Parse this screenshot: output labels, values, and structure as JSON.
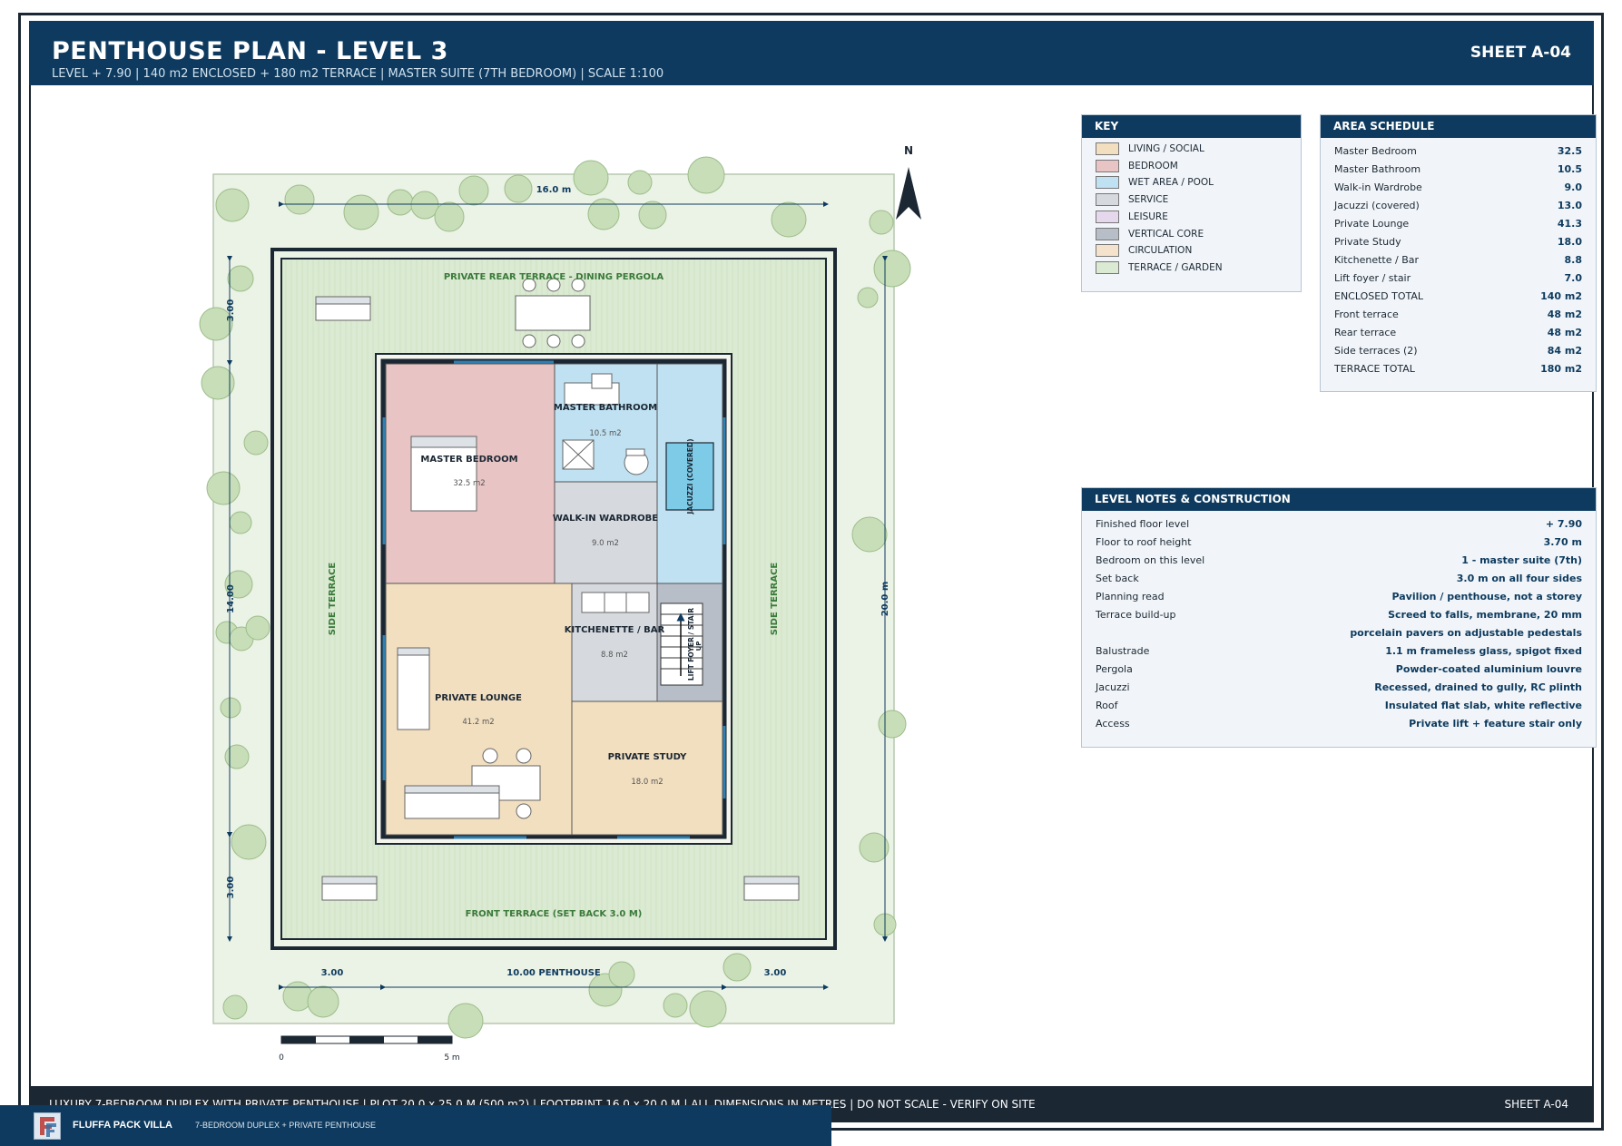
{
  "header": {
    "title": "PENTHOUSE PLAN - LEVEL 3",
    "subtitle": "LEVEL + 7.90  |  140 m2 ENCLOSED + 180 m2 TERRACE  |  MASTER SUITE (7TH BEDROOM)  |  SCALE 1:100",
    "sheet": "SHEET A-04"
  },
  "plan": {
    "north": "N",
    "dims": {
      "top": "16.0 m",
      "right": "20.0 m",
      "left_top": "3.00",
      "left_mid": "14.00",
      "left_bottom": "3.00",
      "bottom_left": "3.00",
      "bottom_mid": "10.00 PENTHOUSE",
      "bottom_right": "3.00"
    },
    "terraces": {
      "rear": "PRIVATE REAR TERRACE  -  DINING PERGOLA",
      "front": "FRONT TERRACE (SET BACK 3.0 M)",
      "side_left": "SIDE TERRACE",
      "side_right": "SIDE TERRACE"
    },
    "rooms": {
      "master_bedroom": {
        "name": "MASTER BEDROOM",
        "area": "32.5 m2"
      },
      "master_bathroom": {
        "name": "MASTER BATHROOM",
        "area": "10.5 m2"
      },
      "walk_in": {
        "name": "WALK-IN WARDROBE",
        "area": "9.0 m2"
      },
      "jacuzzi": {
        "name": "JACUZZI (COVERED)"
      },
      "kitchenette": {
        "name": "KITCHENETTE / BAR",
        "area": "8.8 m2"
      },
      "lift": {
        "name": "LIFT FOYER / STAIR",
        "up": "UP"
      },
      "lounge": {
        "name": "PRIVATE LOUNGE",
        "area": "41.2 m2"
      },
      "study": {
        "name": "PRIVATE STUDY",
        "area": "18.0 m2"
      }
    },
    "scalebar": {
      "start": "0",
      "end": "5 m"
    }
  },
  "key": {
    "title": "KEY",
    "items": [
      {
        "label": "LIVING / SOCIAL",
        "color": "#f2dfc0"
      },
      {
        "label": "BEDROOM",
        "color": "#e8c4c4"
      },
      {
        "label": "WET AREA / POOL",
        "color": "#bfe1f2"
      },
      {
        "label": "SERVICE",
        "color": "#d6d9de"
      },
      {
        "label": "LEISURE",
        "color": "#e6d8ec"
      },
      {
        "label": "VERTICAL CORE",
        "color": "#b7bec7"
      },
      {
        "label": "CIRCULATION",
        "color": "#f4e2cc"
      },
      {
        "label": "TERRACE / GARDEN",
        "color": "#dbead2"
      }
    ]
  },
  "schedule": {
    "title": "AREA SCHEDULE",
    "rows": [
      {
        "label": "Master Bedroom",
        "value": "32.5"
      },
      {
        "label": "Master Bathroom",
        "value": "10.5"
      },
      {
        "label": "Walk-in Wardrobe",
        "value": "9.0"
      },
      {
        "label": "Jacuzzi (covered)",
        "value": "13.0"
      },
      {
        "label": "Private Lounge",
        "value": "41.3"
      },
      {
        "label": "Private Study",
        "value": "18.0"
      },
      {
        "label": "Kitchenette / Bar",
        "value": "8.8"
      },
      {
        "label": "Lift foyer / stair",
        "value": "7.0"
      },
      {
        "label": "ENCLOSED TOTAL",
        "value": "140 m2"
      },
      {
        "label": "Front terrace",
        "value": "48 m2"
      },
      {
        "label": "Rear terrace",
        "value": "48 m2"
      },
      {
        "label": "Side terraces (2)",
        "value": "84 m2"
      },
      {
        "label": "TERRACE TOTAL",
        "value": "180 m2"
      }
    ]
  },
  "notes": {
    "title": "LEVEL NOTES & CONSTRUCTION",
    "rows": [
      {
        "label": "Finished floor level",
        "value": "+ 7.90"
      },
      {
        "label": "Floor to roof height",
        "value": "3.70 m"
      },
      {
        "label": "Bedroom on this level",
        "value": "1 - master suite (7th)"
      },
      {
        "label": "Set back",
        "value": "3.0 m on all four sides"
      },
      {
        "label": "Planning read",
        "value": "Pavilion / penthouse, not a storey"
      },
      {
        "label": "Terrace build-up",
        "value": "Screed to falls, membrane, 20 mm"
      },
      {
        "label": "",
        "value": "porcelain pavers on adjustable pedestals"
      },
      {
        "label": "Balustrade",
        "value": "1.1 m frameless glass, spigot fixed"
      },
      {
        "label": "Pergola",
        "value": "Powder-coated aluminium louvre"
      },
      {
        "label": "Jacuzzi",
        "value": "Recessed, drained to gully, RC plinth"
      },
      {
        "label": "Roof",
        "value": "Insulated flat slab, white reflective"
      },
      {
        "label": "Access",
        "value": "Private lift + feature stair only"
      }
    ]
  },
  "footer": {
    "text": "LUXURY 7-BEDROOM DUPLEX WITH PRIVATE PENTHOUSE   |   PLOT 20.0 x 25.0 M (500 m2)   |   FOOTPRINT 16.0 x 20.0 M   |   ALL DIMENSIONS IN METRES   |   DO NOT SCALE - VERIFY ON SITE",
    "sheet": "SHEET A-04"
  },
  "brand": {
    "name": "FLUFFA PACK VILLA",
    "tagline": "7-BEDROOM DUPLEX + PRIVATE PENTHOUSE"
  }
}
